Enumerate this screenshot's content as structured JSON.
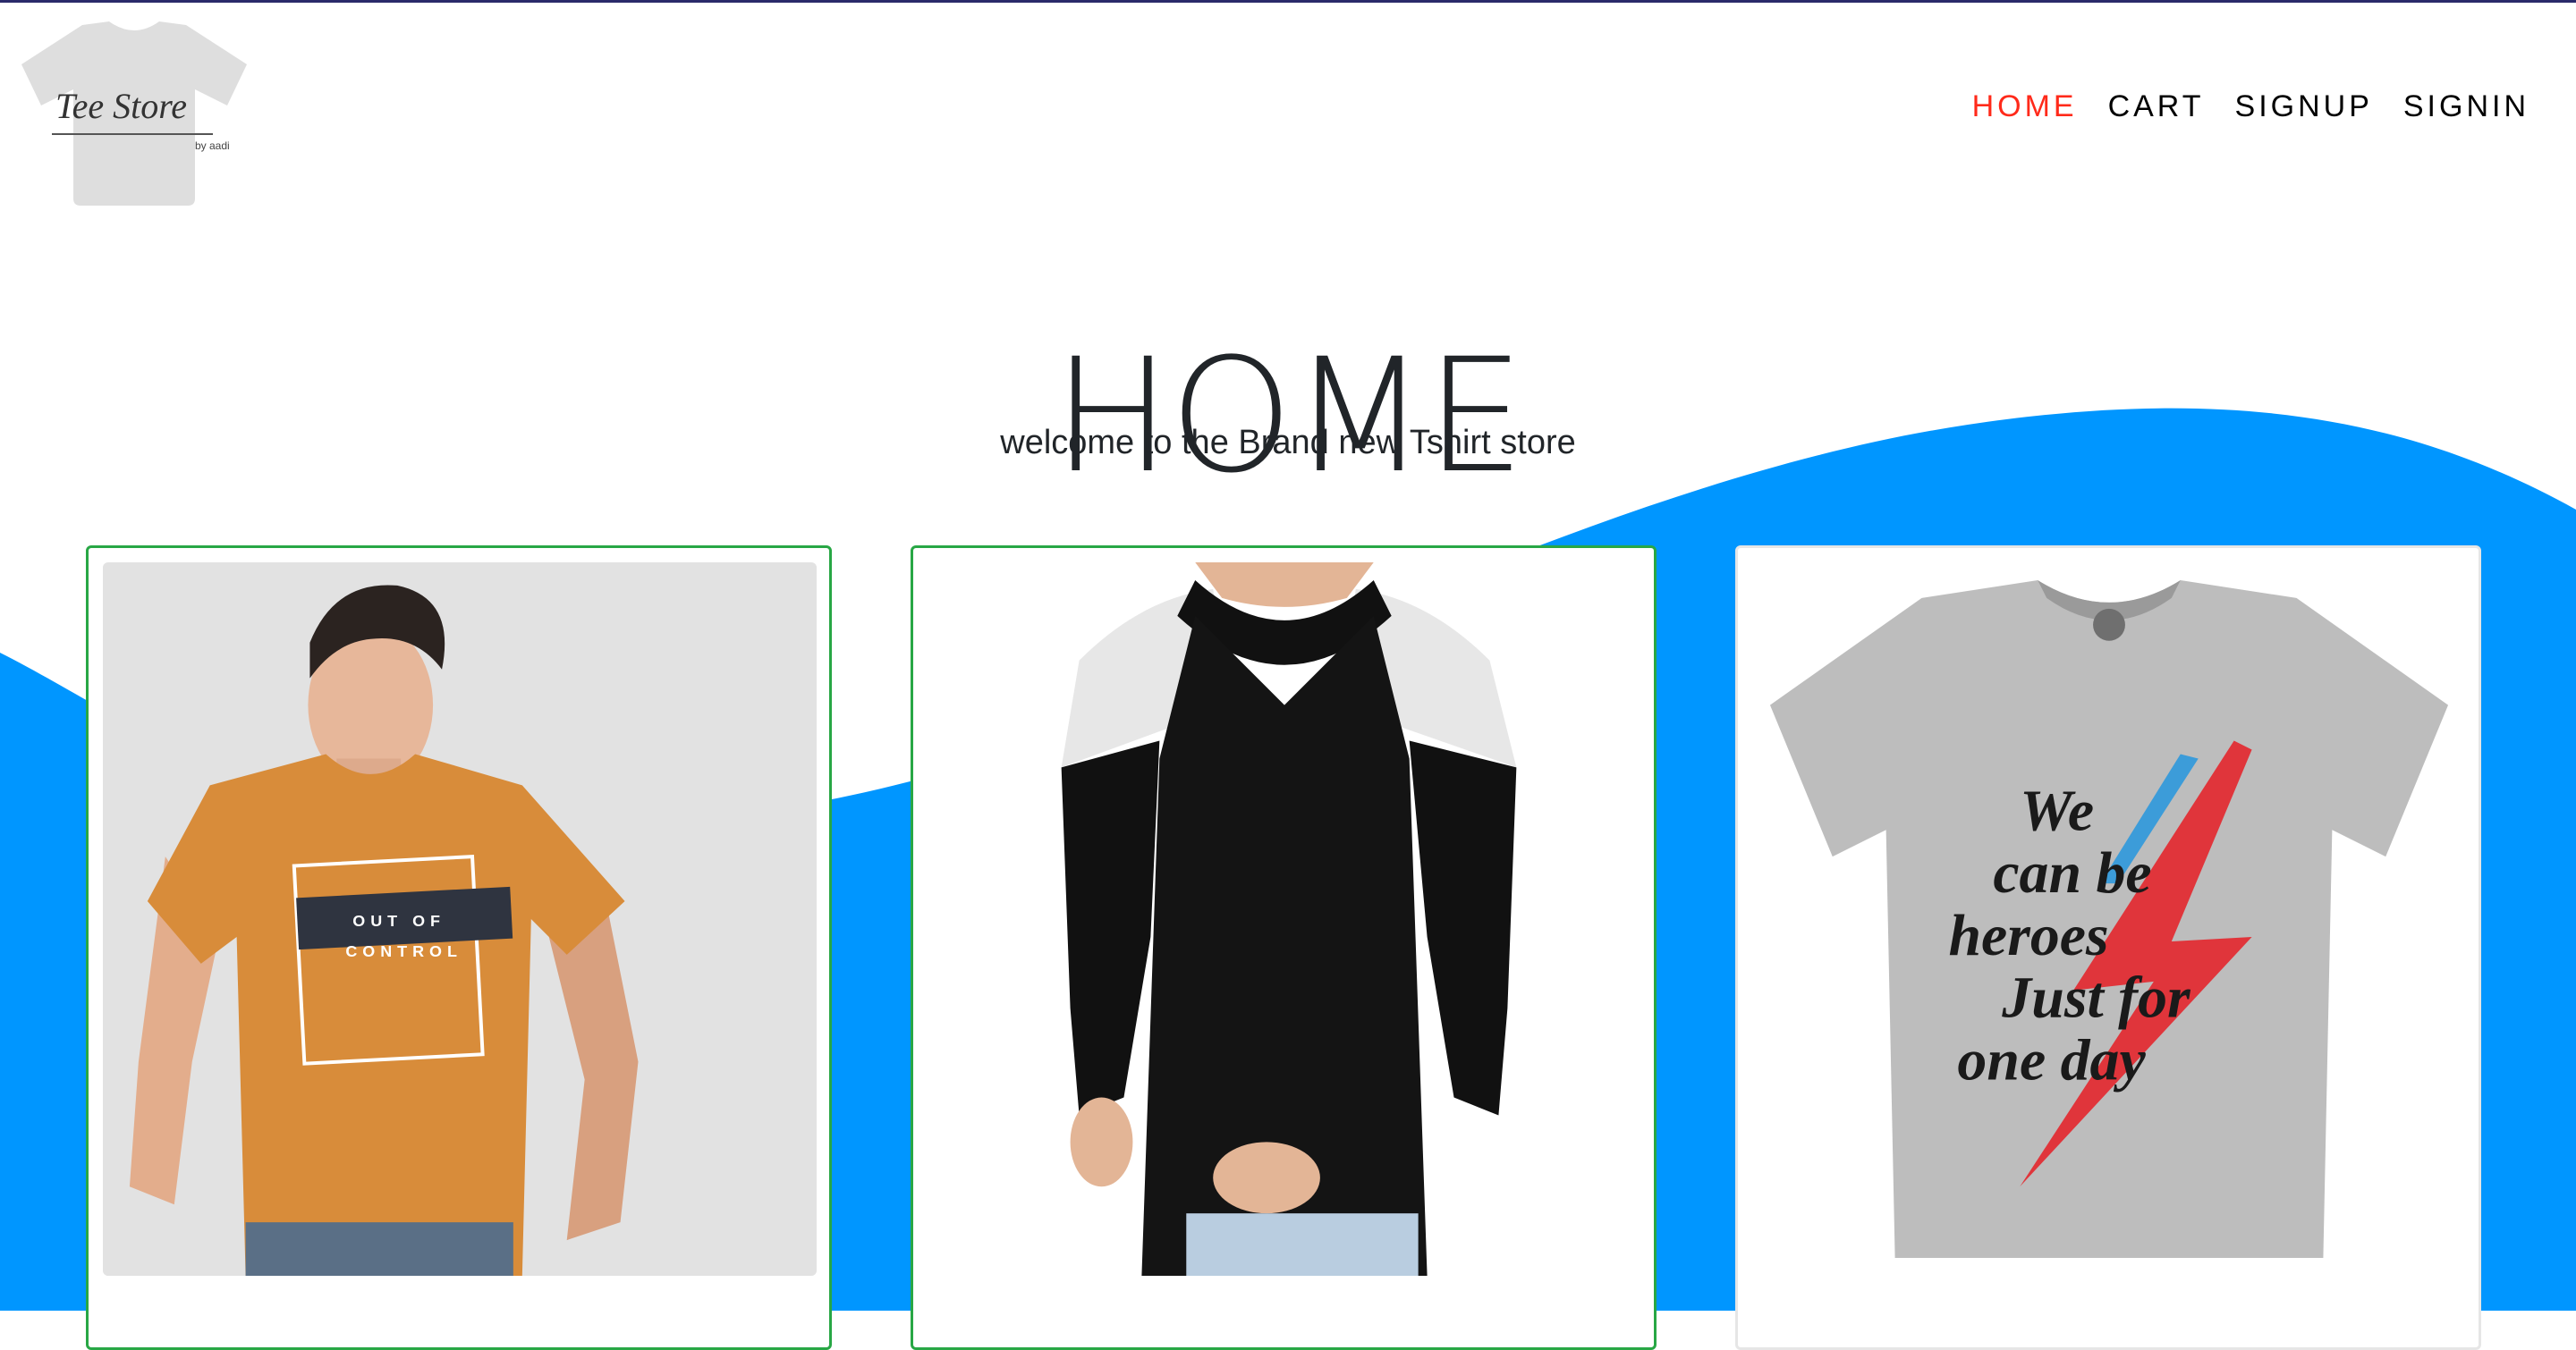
{
  "brand": {
    "name": "Tee Store",
    "byline": "by aadi"
  },
  "nav": {
    "items": [
      {
        "label": "HOME",
        "active": true
      },
      {
        "label": "CART",
        "active": false
      },
      {
        "label": "SIGNUP",
        "active": false
      },
      {
        "label": "SIGNIN",
        "active": false
      }
    ]
  },
  "hero": {
    "title": "HOME",
    "subtitle": "welcome to the Brand new Tshirt store"
  },
  "products": [
    {
      "image": "orange-tshirt-model-image",
      "print_lines": [
        "OUT OF",
        "CONTROL"
      ]
    },
    {
      "image": "black-hoodie-model-image"
    },
    {
      "image": "grey-tshirt-image",
      "print_lines": [
        "We",
        "can be",
        "heroes",
        "Just for",
        "one day"
      ]
    }
  ],
  "colors": {
    "accent_blue": "#0096ff",
    "nav_active": "#ff2a1a",
    "card_border": "#28a745"
  }
}
